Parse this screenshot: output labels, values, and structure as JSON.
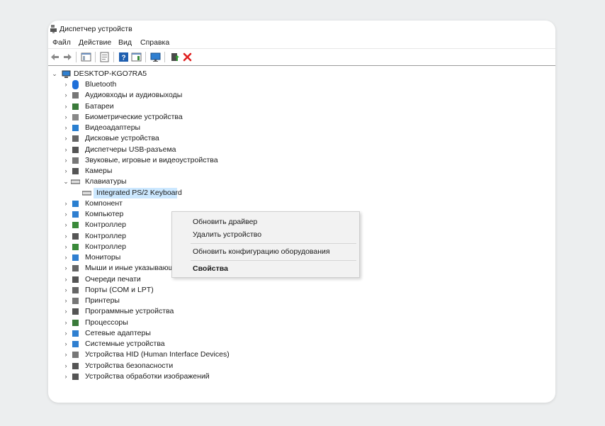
{
  "window": {
    "title": "Диспетчер устройств"
  },
  "menu": [
    "Файл",
    "Действие",
    "Вид",
    "Справка"
  ],
  "toolbar": {
    "icons": [
      "back-arrow-icon",
      "forward-arrow-icon",
      "show-hide-console-tree-icon",
      "properties-icon",
      "help-icon",
      "action-pane-icon",
      "monitor-scan-icon",
      "update-driver-icon",
      "uninstall-red-x-icon"
    ]
  },
  "tree": {
    "root": "DESKTOP-KGO7RA5",
    "items": [
      "Bluetooth",
      "Аудиовходы и аудиовыходы",
      "Батареи",
      "Биометрические устройства",
      "Видеоадаптеры",
      "Дисковые устройства",
      "Диспетчеры USB-разъема",
      "Звуковые, игровые и видеоустройства",
      "Камеры",
      "Клавиатуры",
      "Integrated PS/2 Keyboard",
      "Компоненты программного обеспечения",
      "Компьютер",
      "Контроллеры IDE ATA/ATAPI",
      "Контроллеры USB",
      "Контроллеры запоминающих устройств",
      "Мониторы",
      "Мыши и иные указывающие устройства",
      "Очереди печати",
      "Порты (COM и LPT)",
      "Принтеры",
      "Программные устройства",
      "Процессоры",
      "Сетевые адаптеры",
      "Системные устройства",
      "Устройства HID (Human Interface Devices)",
      "Устройства безопасности",
      "Устройства обработки изображений"
    ],
    "visible_labels": [
      "Bluetooth",
      "Аудиовходы и аудиовыходы",
      "Батареи",
      "Биометрические устройства",
      "Видеоадаптеры",
      "Дисковые устройства",
      "Диспетчеры USB-разъема",
      "Звуковые, игровые и видеоустройства",
      "Камеры",
      "Клавиатуры",
      "Integrated PS/2 Keyboard",
      "Компонент",
      "Компьютер",
      "Контроллер",
      "Контроллер",
      "Контроллер",
      "Мониторы",
      "Мыши и иные указывающие устройства",
      "Очереди печати",
      "Порты (COM и LPT)",
      "Принтеры",
      "Программные устройства",
      "Процессоры",
      "Сетевые адаптеры",
      "Системные устройства",
      "Устройства HID (Human Interface Devices)",
      "Устройства безопасности",
      "Устройства обработки изображений"
    ]
  },
  "context_menu": {
    "update_driver": "Обновить драйвер",
    "uninstall_device": "Удалить устройство",
    "scan_hardware": "Обновить конфигурацию оборудования",
    "properties": "Свойства"
  },
  "colors": {
    "selection": "#cce8ff",
    "accent_blue": "#1a73c9",
    "delete_red": "#e02020"
  }
}
